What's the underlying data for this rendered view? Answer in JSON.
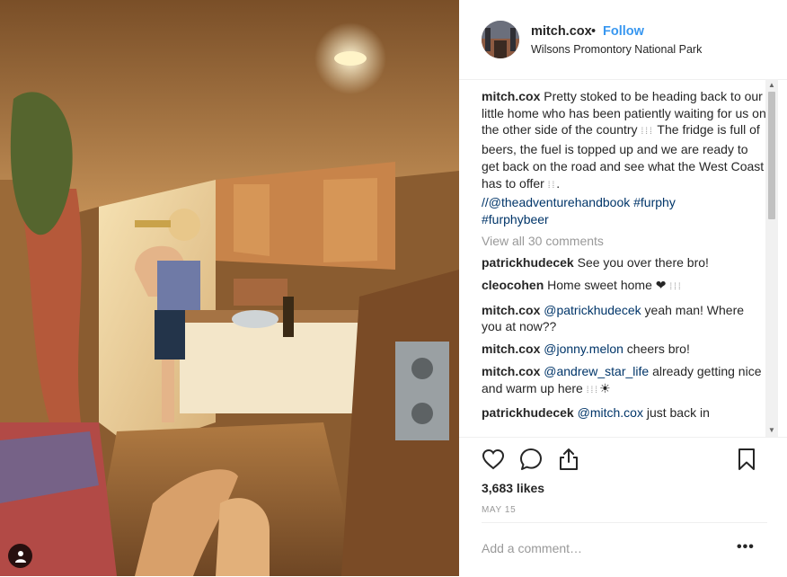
{
  "post": {
    "username": "mitch.cox",
    "separator": "•",
    "follow_label": "Follow",
    "location": "Wilsons Promontory National Park",
    "caption": {
      "author": "mitch.cox",
      "text": " Pretty stoked to be heading back to our little home who has been patiently waiting for us on the other side of the country ",
      "glyph1": "⁞⁞⁞",
      "text2": " The fridge is full of beers, the fuel is topped up and we are ready to get back on the road and see what the West Coast has to offer ",
      "glyph2": "⁞⁞",
      "text3": ".",
      "mention": "//@theadventurehandbook",
      "hashtag1": "#furphy",
      "hashtag2": "#furphybeer"
    },
    "view_all_comments": "View all 30 comments",
    "comments": [
      {
        "author": "patrickhudecek",
        "text": " See you over there bro!"
      },
      {
        "author": "cleocohen",
        "text": " Home sweet home ",
        "emoji": "❤",
        "tail": "⁞⁞⁞"
      },
      {
        "author": "mitch.cox",
        "mention": "@patrickhudecek",
        "text": " yeah man! Where you at now??"
      },
      {
        "author": "mitch.cox",
        "mention": "@jonny.melon",
        "text": " cheers bro!"
      },
      {
        "author": "mitch.cox",
        "mention": "@andrew_star_life",
        "text": " already getting nice and warm up here ",
        "tail": "⁞⁞⁞",
        "emoji": "☀"
      },
      {
        "author": "patrickhudecek",
        "mention": "@mitch.cox",
        "text": " just back in"
      }
    ],
    "likes": "3,683 likes",
    "date": "MAY 15",
    "add_comment_placeholder": "Add a comment…",
    "more_label": "•••"
  },
  "icons": {
    "like": "heart-icon",
    "comment": "comment-icon",
    "share": "share-icon",
    "save": "bookmark-icon",
    "user_tag": "person-icon"
  },
  "colors": {
    "link": "#003569",
    "follow": "#3897f0",
    "muted": "#999999",
    "text": "#262626"
  }
}
